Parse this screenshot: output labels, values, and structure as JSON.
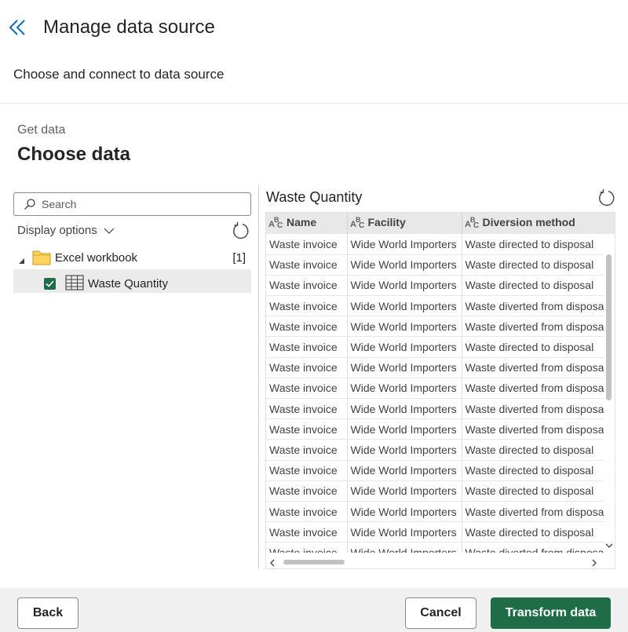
{
  "header": {
    "back_icon": "double-chevron-left-icon",
    "title": "Manage data source",
    "subtitle": "Choose and connect to data source"
  },
  "section": {
    "breadcrumb": "Get data",
    "heading": "Choose data"
  },
  "navigator": {
    "search_placeholder": "Search",
    "display_options_label": "Display options",
    "tree": {
      "group_label": "Excel workbook",
      "group_count": "[1]",
      "item_label": "Waste Quantity",
      "item_checked": true
    }
  },
  "preview": {
    "title": "Waste Quantity",
    "columns": [
      "Name",
      "Facility",
      "Diversion method"
    ],
    "rows": [
      [
        "Waste invoice",
        "Wide World Importers",
        "Waste directed to disposal"
      ],
      [
        "Waste invoice",
        "Wide World Importers",
        "Waste directed to disposal"
      ],
      [
        "Waste invoice",
        "Wide World Importers",
        "Waste directed to disposal"
      ],
      [
        "Waste invoice",
        "Wide World Importers",
        "Waste diverted from disposal"
      ],
      [
        "Waste invoice",
        "Wide World Importers",
        "Waste diverted from disposal"
      ],
      [
        "Waste invoice",
        "Wide World Importers",
        "Waste directed to disposal"
      ],
      [
        "Waste invoice",
        "Wide World Importers",
        "Waste diverted from disposal"
      ],
      [
        "Waste invoice",
        "Wide World Importers",
        "Waste diverted from disposal"
      ],
      [
        "Waste invoice",
        "Wide World Importers",
        "Waste diverted from disposal"
      ],
      [
        "Waste invoice",
        "Wide World Importers",
        "Waste diverted from disposal"
      ],
      [
        "Waste invoice",
        "Wide World Importers",
        "Waste directed to disposal"
      ],
      [
        "Waste invoice",
        "Wide World Importers",
        "Waste directed to disposal"
      ],
      [
        "Waste invoice",
        "Wide World Importers",
        "Waste directed to disposal"
      ],
      [
        "Waste invoice",
        "Wide World Importers",
        "Waste diverted from disposal"
      ],
      [
        "Waste invoice",
        "Wide World Importers",
        "Waste directed to disposal"
      ],
      [
        "Waste invoice",
        "Wide World Importers",
        "Waste diverted from disposal"
      ]
    ]
  },
  "footer": {
    "back_label": "Back",
    "cancel_label": "Cancel",
    "transform_label": "Transform data"
  },
  "colors": {
    "primary": "#1f6d48",
    "link": "#0f6cbd"
  }
}
